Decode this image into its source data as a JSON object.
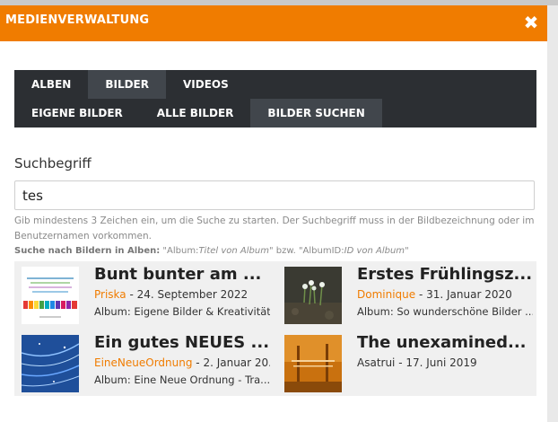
{
  "modal": {
    "title": "MEDIENVERWALTUNG",
    "close_symbol": "✖"
  },
  "tabs": {
    "row1": [
      {
        "label": "ALBEN",
        "active": false
      },
      {
        "label": "BILDER",
        "active": true
      },
      {
        "label": "VIDEOS",
        "active": false
      }
    ],
    "row2": [
      {
        "label": "EIGENE BILDER",
        "active": false
      },
      {
        "label": "ALLE BILDER",
        "active": false
      },
      {
        "label": "BILDER SUCHEN",
        "active": true
      }
    ]
  },
  "search": {
    "label": "Suchbegriff",
    "value": "tes",
    "hint": "Gib mindestens 3 Zeichen ein, um die Suche zu starten. Der Suchbegriff muss in der Bildbezeichnung oder im Benutzernamen vorkommen.",
    "album_hint": {
      "prefix": "Suche nach Bildern in Alben:",
      "part1": " \"Album:",
      "italic1": "Titel von Album",
      "part2": "\" bzw. \"AlbumID:",
      "italic2": "ID von Album",
      "part3": "\""
    }
  },
  "results": [
    {
      "title": "Bunt bunter am ...",
      "user": "Priska",
      "date": " - 24. September 2022",
      "album": "Album: Eigene Bilder & Kreativität"
    },
    {
      "title": "Erstes Frühlingsz...",
      "user": "Dominique",
      "date": " - 31. Januar 2020",
      "album": "Album: So wunderschöne Bilder ..."
    },
    {
      "title": "Ein gutes NEUES ...",
      "user": "EineNeueOrdnung",
      "date": " - 2. Januar 20...",
      "album": "Album: Eine Neue Ordnung - Tra..."
    },
    {
      "title": "The unexamined...",
      "user": "",
      "date": "Asatrui - 17. Juni 2019",
      "album": ""
    }
  ],
  "colors": {
    "accent": "#f07c00",
    "tab_bg": "#2c2f33",
    "tab_active": "#41464c"
  }
}
